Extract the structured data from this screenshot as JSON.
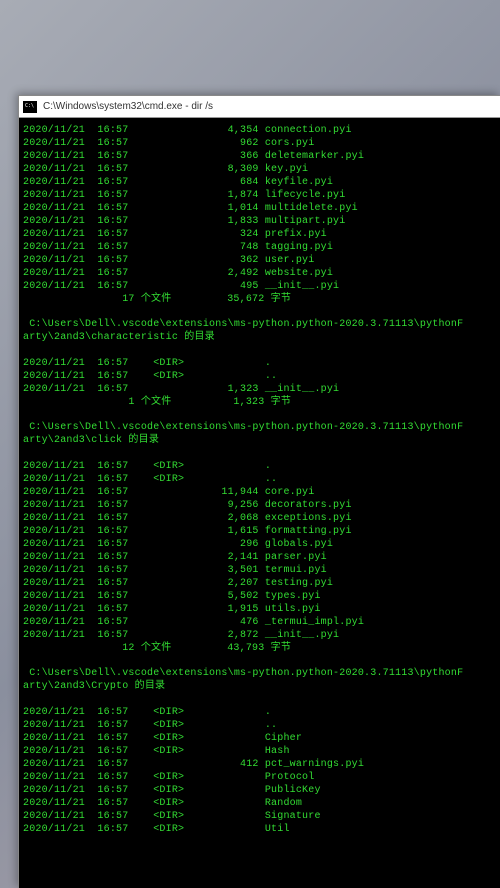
{
  "window": {
    "title": "C:\\Windows\\system32\\cmd.exe - dir /s"
  },
  "sections": [
    {
      "header": null,
      "rows": [
        {
          "date": "2020/11/21",
          "time": "16:57",
          "type": "",
          "size": "4,354",
          "name": "connection.pyi"
        },
        {
          "date": "2020/11/21",
          "time": "16:57",
          "type": "",
          "size": "962",
          "name": "cors.pyi"
        },
        {
          "date": "2020/11/21",
          "time": "16:57",
          "type": "",
          "size": "366",
          "name": "deletemarker.pyi"
        },
        {
          "date": "2020/11/21",
          "time": "16:57",
          "type": "",
          "size": "8,309",
          "name": "key.pyi"
        },
        {
          "date": "2020/11/21",
          "time": "16:57",
          "type": "",
          "size": "684",
          "name": "keyfile.pyi"
        },
        {
          "date": "2020/11/21",
          "time": "16:57",
          "type": "",
          "size": "1,874",
          "name": "lifecycle.pyi"
        },
        {
          "date": "2020/11/21",
          "time": "16:57",
          "type": "",
          "size": "1,014",
          "name": "multidelete.pyi"
        },
        {
          "date": "2020/11/21",
          "time": "16:57",
          "type": "",
          "size": "1,833",
          "name": "multipart.pyi"
        },
        {
          "date": "2020/11/21",
          "time": "16:57",
          "type": "",
          "size": "324",
          "name": "prefix.pyi"
        },
        {
          "date": "2020/11/21",
          "time": "16:57",
          "type": "",
          "size": "748",
          "name": "tagging.pyi"
        },
        {
          "date": "2020/11/21",
          "time": "16:57",
          "type": "",
          "size": "362",
          "name": "user.pyi"
        },
        {
          "date": "2020/11/21",
          "time": "16:57",
          "type": "",
          "size": "2,492",
          "name": "website.pyi"
        },
        {
          "date": "2020/11/21",
          "time": "16:57",
          "type": "",
          "size": "495",
          "name": "__init__.pyi"
        }
      ],
      "summary": {
        "count": "17 个文件",
        "bytes": "35,672 字节"
      }
    },
    {
      "header": " C:\\Users\\Dell\\.vscode\\extensions\\ms-python.python-2020.3.71113\\pythonF\narty\\2and3\\characteristic 的目录",
      "rows": [
        {
          "date": "2020/11/21",
          "time": "16:57",
          "type": "<DIR>",
          "size": "",
          "name": "."
        },
        {
          "date": "2020/11/21",
          "time": "16:57",
          "type": "<DIR>",
          "size": "",
          "name": ".."
        },
        {
          "date": "2020/11/21",
          "time": "16:57",
          "type": "",
          "size": "1,323",
          "name": "__init__.pyi"
        }
      ],
      "summary": {
        "count": "1 个文件",
        "bytes": "1,323 字节"
      }
    },
    {
      "header": " C:\\Users\\Dell\\.vscode\\extensions\\ms-python.python-2020.3.71113\\pythonF\narty\\2and3\\click 的目录",
      "rows": [
        {
          "date": "2020/11/21",
          "time": "16:57",
          "type": "<DIR>",
          "size": "",
          "name": "."
        },
        {
          "date": "2020/11/21",
          "time": "16:57",
          "type": "<DIR>",
          "size": "",
          "name": ".."
        },
        {
          "date": "2020/11/21",
          "time": "16:57",
          "type": "",
          "size": "11,944",
          "name": "core.pyi"
        },
        {
          "date": "2020/11/21",
          "time": "16:57",
          "type": "",
          "size": "9,256",
          "name": "decorators.pyi"
        },
        {
          "date": "2020/11/21",
          "time": "16:57",
          "type": "",
          "size": "2,068",
          "name": "exceptions.pyi"
        },
        {
          "date": "2020/11/21",
          "time": "16:57",
          "type": "",
          "size": "1,615",
          "name": "formatting.pyi"
        },
        {
          "date": "2020/11/21",
          "time": "16:57",
          "type": "",
          "size": "296",
          "name": "globals.pyi"
        },
        {
          "date": "2020/11/21",
          "time": "16:57",
          "type": "",
          "size": "2,141",
          "name": "parser.pyi"
        },
        {
          "date": "2020/11/21",
          "time": "16:57",
          "type": "",
          "size": "3,501",
          "name": "termui.pyi"
        },
        {
          "date": "2020/11/21",
          "time": "16:57",
          "type": "",
          "size": "2,207",
          "name": "testing.pyi"
        },
        {
          "date": "2020/11/21",
          "time": "16:57",
          "type": "",
          "size": "5,502",
          "name": "types.pyi"
        },
        {
          "date": "2020/11/21",
          "time": "16:57",
          "type": "",
          "size": "1,915",
          "name": "utils.pyi"
        },
        {
          "date": "2020/11/21",
          "time": "16:57",
          "type": "",
          "size": "476",
          "name": "_termui_impl.pyi"
        },
        {
          "date": "2020/11/21",
          "time": "16:57",
          "type": "",
          "size": "2,872",
          "name": "__init__.pyi"
        }
      ],
      "summary": {
        "count": "12 个文件",
        "bytes": "43,793 字节"
      }
    },
    {
      "header": " C:\\Users\\Dell\\.vscode\\extensions\\ms-python.python-2020.3.71113\\pythonF\narty\\2and3\\Crypto 的目录",
      "rows": [
        {
          "date": "2020/11/21",
          "time": "16:57",
          "type": "<DIR>",
          "size": "",
          "name": "."
        },
        {
          "date": "2020/11/21",
          "time": "16:57",
          "type": "<DIR>",
          "size": "",
          "name": ".."
        },
        {
          "date": "2020/11/21",
          "time": "16:57",
          "type": "<DIR>",
          "size": "",
          "name": "Cipher"
        },
        {
          "date": "2020/11/21",
          "time": "16:57",
          "type": "<DIR>",
          "size": "",
          "name": "Hash"
        },
        {
          "date": "2020/11/21",
          "time": "16:57",
          "type": "",
          "size": "412",
          "name": "pct_warnings.pyi"
        },
        {
          "date": "2020/11/21",
          "time": "16:57",
          "type": "<DIR>",
          "size": "",
          "name": "Protocol"
        },
        {
          "date": "2020/11/21",
          "time": "16:57",
          "type": "<DIR>",
          "size": "",
          "name": "PublicKey"
        },
        {
          "date": "2020/11/21",
          "time": "16:57",
          "type": "<DIR>",
          "size": "",
          "name": "Random"
        },
        {
          "date": "2020/11/21",
          "time": "16:57",
          "type": "<DIR>",
          "size": "",
          "name": "Signature"
        },
        {
          "date": "2020/11/21",
          "time": "16:57",
          "type": "<DIR>",
          "size": "",
          "name": "Util"
        }
      ],
      "summary": null
    }
  ]
}
